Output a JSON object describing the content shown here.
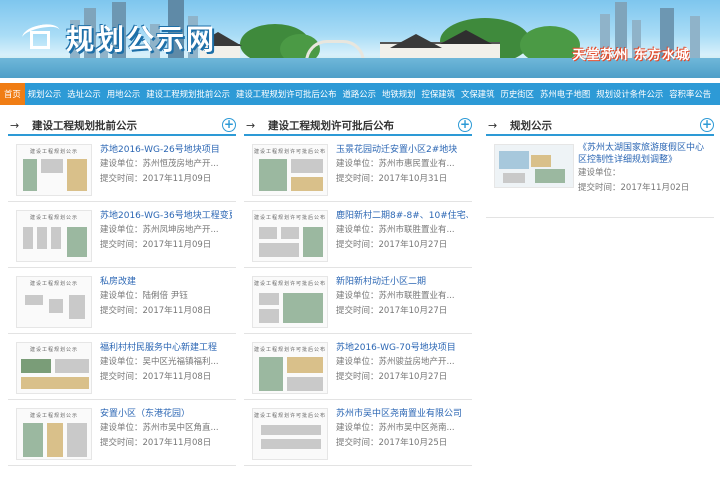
{
  "banner": {
    "site_title": "规划公示网",
    "slogan": "天堂苏州  东方水城"
  },
  "nav": [
    {
      "label": "首页"
    },
    {
      "label": "规划公示"
    },
    {
      "label": "选址公示"
    },
    {
      "label": "用地公示"
    },
    {
      "label": "建设工程规划批前公示"
    },
    {
      "label": "建设工程规划许可批后公布"
    },
    {
      "label": "道路公示"
    },
    {
      "label": "地铁规划"
    },
    {
      "label": "控保建筑"
    },
    {
      "label": "文保建筑"
    },
    {
      "label": "历史街区"
    },
    {
      "label": "苏州电子地图"
    },
    {
      "label": "规划设计条件公示"
    },
    {
      "label": "容积率公告"
    }
  ],
  "columns": [
    {
      "title": "建设工程规划批前公示",
      "items": [
        {
          "thumb_title": "建设工程规划公示",
          "name": "苏地2016-WG-26号地块项目",
          "unit": "建设单位：苏州恒茂房地产开...",
          "date": "提交时间：2017年11月09日"
        },
        {
          "thumb_title": "建设工程规划公示",
          "name": "苏地2016-WG-36号地块工程变更",
          "unit": "建设单位：苏州凤坤房地产开...",
          "date": "提交时间：2017年11月09日"
        },
        {
          "thumb_title": "建设工程规划公示",
          "name": "私房改建",
          "unit": "建设单位：陆俐倍 尹钰",
          "date": "提交时间：2017年11月08日"
        },
        {
          "thumb_title": "建设工程规划公示",
          "name": "福利村村民服务中心新建工程",
          "unit": "建设单位：吴中区光福镇福利...",
          "date": "提交时间：2017年11月08日"
        },
        {
          "thumb_title": "建设工程规划公示",
          "name": "安置小区（东港花园）",
          "unit": "建设单位：苏州市吴中区角直...",
          "date": "提交时间：2017年11月08日"
        }
      ]
    },
    {
      "title": "建设工程规划许可批后公布",
      "items": [
        {
          "thumb_title": "建设工程规划许可批后公布",
          "name": "玉景花园动迁安置小区2#地块",
          "unit": "建设单位：苏州市惠民置业有...",
          "date": "提交时间：2017年10月31日"
        },
        {
          "thumb_title": "建设工程规划许可批后公布",
          "name": "鹿阳新村二期8#-8#、10#住宅、...",
          "unit": "建设单位：苏州市联胜置业有...",
          "date": "提交时间：2017年10月27日"
        },
        {
          "thumb_title": "建设工程规划许可批后公布",
          "name": "新阳新村动迁小区二期",
          "unit": "建设单位：苏州市联胜置业有...",
          "date": "提交时间：2017年10月27日"
        },
        {
          "thumb_title": "建设工程规划许可批后公布",
          "name": "苏地2016-WG-70号地块项目",
          "unit": "建设单位：苏州骏益房地产开...",
          "date": "提交时间：2017年10月27日"
        },
        {
          "thumb_title": "建设工程规划许可批后公布",
          "name": "苏州市吴中区尧南置业有限公司",
          "unit": "建设单位：苏州市吴中区尧南...",
          "date": "提交时间：2017年10月25日"
        }
      ]
    },
    {
      "title": "规划公示",
      "items": [
        {
          "thumb_title": "",
          "name": "《苏州太湖国家旅游度假区中心区控制性详细规划调整》",
          "unit": "建设单位：",
          "date": "提交时间：2017年11月02日"
        }
      ]
    }
  ],
  "colors": {
    "nav_bg": "#2d9ad6",
    "nav_active": "#f07d14",
    "link": "#2c67b4"
  }
}
